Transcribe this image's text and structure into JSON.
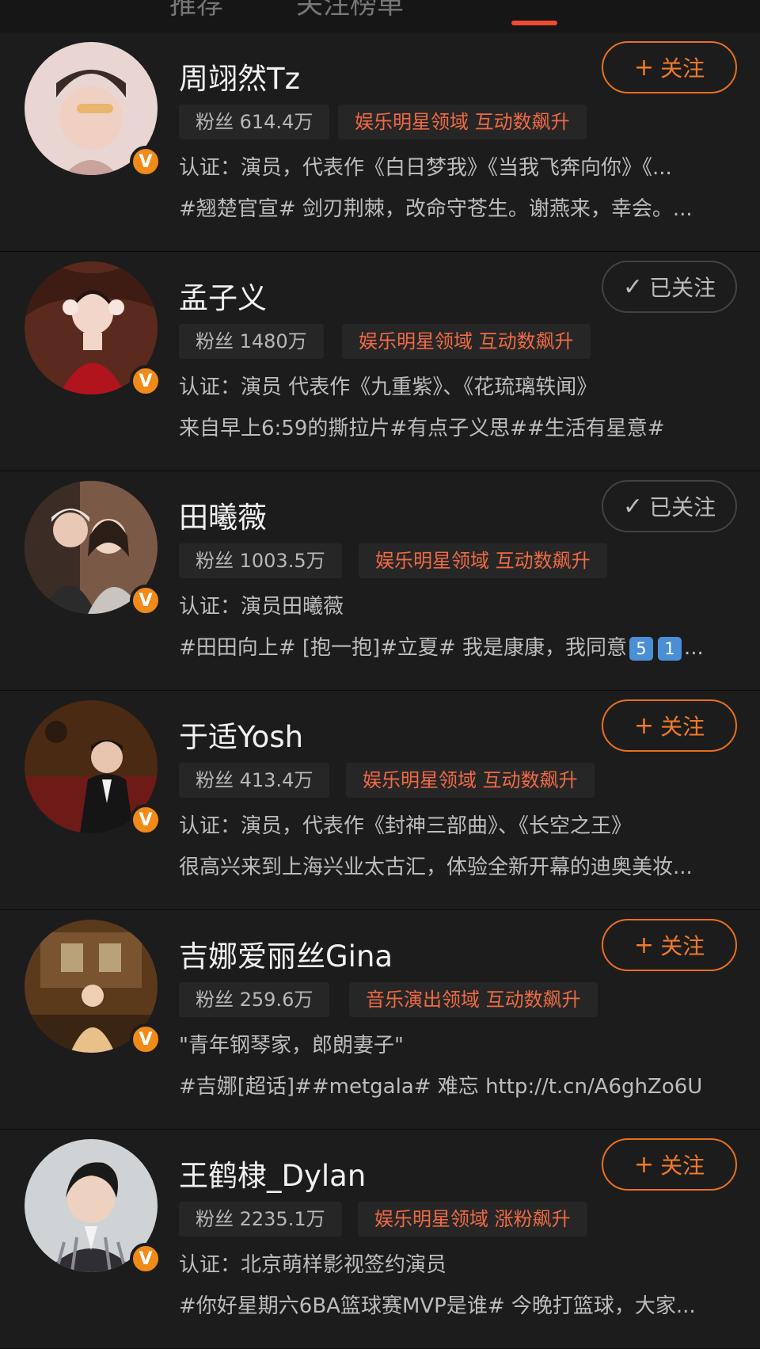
{
  "tabs": [
    {
      "label": "推荐"
    },
    {
      "label": "关注榜单"
    },
    {
      "label": ""
    }
  ],
  "users": [
    {
      "name": "周翊然Tz",
      "fans": "粉丝 614.4万",
      "domain": "娱乐明星领域 互动数飙升",
      "desc": "认证：演员，代表作《白日梦我》《当我飞奔向你》《...",
      "post": "#翘楚官宣# 剑刃荆棘，改命守苍生。谢燕来，幸会。...",
      "follow_state": "follow",
      "button_label": "关注",
      "avatar_icon": "avatar-photo"
    },
    {
      "name": "孟子义",
      "fans": "粉丝 1480万",
      "domain": "娱乐明星领域 互动数飙升",
      "desc": "认证：演员 代表作《九重紫》、《花琉璃轶闻》",
      "post": "来自早上6:59的撕拉片#有点子义思##生活有星意#",
      "follow_state": "followed",
      "button_label": "已关注",
      "avatar_icon": "avatar-photo"
    },
    {
      "name": "田曦薇",
      "fans": "粉丝 1003.5万",
      "domain": "娱乐明星领域 互动数飙升",
      "desc": "认证：演员田曦薇",
      "post": "#田田向上# [抱一抱]#立夏# 我是康康，我同意",
      "post_emoji": [
        "5",
        "1"
      ],
      "post_suffix": "...",
      "follow_state": "followed",
      "button_label": "已关注",
      "avatar_icon": "avatar-photo"
    },
    {
      "name": "于适Yosh",
      "fans": "粉丝 413.4万",
      "domain": "娱乐明星领域 互动数飙升",
      "desc": "认证：演员，代表作《封神三部曲》、《长空之王》",
      "post": "很高兴来到上海兴业太古汇，体验全新开幕的迪奥美妆...",
      "follow_state": "follow",
      "button_label": "关注",
      "avatar_icon": "avatar-photo"
    },
    {
      "name": "吉娜爱丽丝Gina",
      "fans": "粉丝 259.6万",
      "domain": "音乐演出领域 互动数飙升",
      "desc": "\"青年钢琴家，郎朗妻子\"",
      "post": "#吉娜[超话]##metgala# 难忘 http://t.cn/A6ghZo6U",
      "follow_state": "follow",
      "button_label": "关注",
      "avatar_icon": "avatar-photo"
    },
    {
      "name": "王鹤棣_Dylan",
      "fans": "粉丝 2235.1万",
      "domain": "娱乐明星领域 涨粉飙升",
      "desc": "认证：北京萌样影视签约演员",
      "post": "#你好星期六6BA篮球赛MVP是谁# 今晚打篮球，大家...",
      "follow_state": "follow",
      "button_label": "关注",
      "avatar_icon": "avatar-photo"
    }
  ],
  "colors": {
    "accent": "#f07a2a",
    "domain_text": "#f06a45",
    "badge": "#f08a18",
    "background": "#161616",
    "card": "#1c1c1c"
  }
}
